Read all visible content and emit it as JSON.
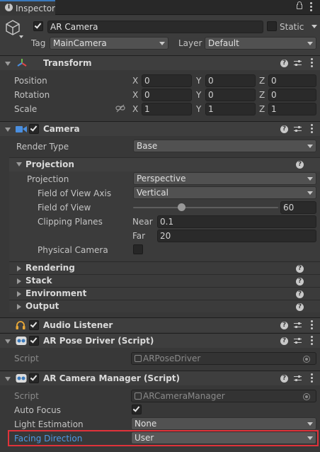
{
  "tab": {
    "title": "Inspector"
  },
  "gameobject": {
    "name": "AR Camera",
    "static_label": "Static",
    "tag_label": "Tag",
    "tag_value": "MainCamera",
    "layer_label": "Layer",
    "layer_value": "Default"
  },
  "transform": {
    "title": "Transform",
    "position": {
      "label": "Position",
      "x": "0",
      "y": "0",
      "z": "0"
    },
    "rotation": {
      "label": "Rotation",
      "x": "0",
      "y": "0",
      "z": "0"
    },
    "scale": {
      "label": "Scale",
      "x": "1",
      "y": "1",
      "z": "1"
    },
    "axis": {
      "x": "X",
      "y": "Y",
      "z": "Z"
    }
  },
  "camera": {
    "title": "Camera",
    "render_type_label": "Render Type",
    "render_type_value": "Base",
    "projection_section": "Projection",
    "projection_label": "Projection",
    "projection_value": "Perspective",
    "fov_axis_label": "Field of View Axis",
    "fov_axis_value": "Vertical",
    "fov_label": "Field of View",
    "fov_value": "60",
    "fov_fraction": 0.33,
    "clipping_label": "Clipping Planes",
    "near_label": "Near",
    "near_value": "0.1",
    "far_label": "Far",
    "far_value": "20",
    "physical_label": "Physical Camera",
    "sections": [
      "Rendering",
      "Stack",
      "Environment",
      "Output"
    ]
  },
  "audio_listener": {
    "title": "Audio Listener"
  },
  "pose_driver": {
    "title": "AR Pose Driver (Script)",
    "script_label": "Script",
    "script_value": "ARPoseDriver"
  },
  "camera_manager": {
    "title": "AR Camera Manager (Script)",
    "script_label": "Script",
    "script_value": "ARCameraManager",
    "auto_focus_label": "Auto Focus",
    "light_estimation_label": "Light Estimation",
    "light_estimation_value": "None",
    "facing_label": "Facing Direction",
    "facing_value": "User"
  },
  "colors": {
    "highlight": "#e0323a",
    "facing_label": "#4d9be6"
  }
}
